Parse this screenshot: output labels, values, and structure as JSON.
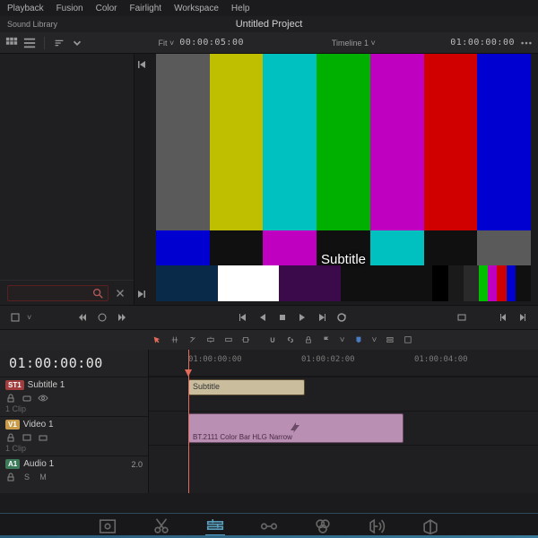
{
  "menu": {
    "items": [
      "Playback",
      "Fusion",
      "Color",
      "Fairlight",
      "Workspace",
      "Help"
    ]
  },
  "titlebar": {
    "soundLibrary": "Sound Library",
    "projectTitle": "Untitled Project"
  },
  "viewer": {
    "fitLabel": "Fit",
    "leftTimecode": "00:00:05:00",
    "timelineDropdown": "Timeline 1",
    "rightTimecode": "01:00:00:00",
    "subtitleText": "Subtitle"
  },
  "timeline": {
    "bigTimecode": "01:00:00:00",
    "rulerTicks": [
      "01:00:00:00",
      "01:00:02:00",
      "01:00:04:00"
    ],
    "tracks": {
      "subtitle": {
        "badge": "ST1",
        "name": "Subtitle 1",
        "meta": "1 Clip",
        "clipLabel": "Subtitle"
      },
      "video": {
        "badge": "V1",
        "name": "Video 1",
        "meta": "1 Clip",
        "clipLabel": "BT.2111 Color Bar HLG Narrow"
      },
      "audio": {
        "badge": "A1",
        "name": "Audio 1",
        "level": "2.0"
      }
    }
  },
  "colorbars": {
    "top": [
      "#5a5a5a",
      "#bfbf00",
      "#00c0c0",
      "#00b000",
      "#c000c0",
      "#d00000",
      "#0000d0"
    ],
    "mid": [
      "#0000d0",
      "#101010",
      "#c000c0",
      "#101010",
      "#00c0c0",
      "#101010",
      "#5a5a5a"
    ]
  }
}
